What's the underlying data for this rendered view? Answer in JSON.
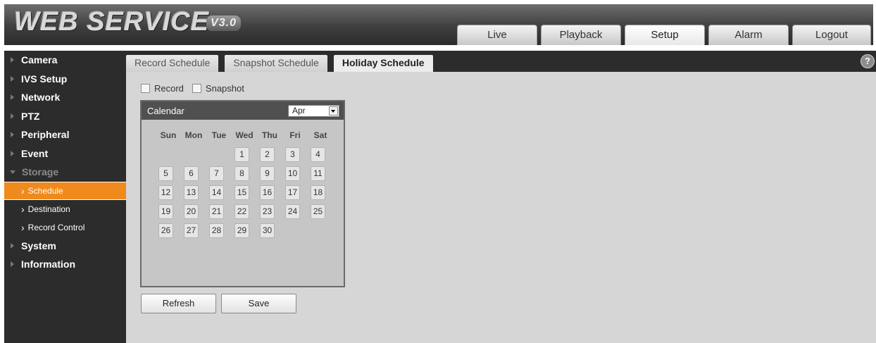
{
  "header": {
    "logo_text": "WEB SERVICE",
    "logo_version": "V3.0",
    "nav": [
      {
        "label": "Live",
        "active": false
      },
      {
        "label": "Playback",
        "active": false
      },
      {
        "label": "Setup",
        "active": true
      },
      {
        "label": "Alarm",
        "active": false
      },
      {
        "label": "Logout",
        "active": false
      }
    ]
  },
  "sidebar": {
    "items": [
      {
        "label": "Camera"
      },
      {
        "label": "IVS Setup"
      },
      {
        "label": "Network"
      },
      {
        "label": "PTZ"
      },
      {
        "label": "Peripheral"
      },
      {
        "label": "Event"
      },
      {
        "label": "Storage",
        "expanded": true
      },
      {
        "label": "System"
      },
      {
        "label": "Information"
      }
    ],
    "storage_children": [
      {
        "label": "Schedule",
        "active": true
      },
      {
        "label": "Destination",
        "active": false
      },
      {
        "label": "Record Control",
        "active": false
      }
    ],
    "accent_color": "#f08a1c"
  },
  "subtabs": [
    {
      "label": "Record Schedule",
      "active": false
    },
    {
      "label": "Snapshot Schedule",
      "active": false
    },
    {
      "label": "Holiday Schedule",
      "active": true
    }
  ],
  "help_icon": "?",
  "options": {
    "record_label": "Record",
    "record_checked": false,
    "snapshot_label": "Snapshot",
    "snapshot_checked": false
  },
  "calendar": {
    "title": "Calendar",
    "month": "Apr",
    "weekdays": [
      "Sun",
      "Mon",
      "Tue",
      "Wed",
      "Thu",
      "Fri",
      "Sat"
    ],
    "first_weekday_index": 3,
    "days": [
      "1",
      "2",
      "3",
      "4",
      "5",
      "6",
      "7",
      "8",
      "9",
      "10",
      "11",
      "12",
      "13",
      "14",
      "15",
      "16",
      "17",
      "18",
      "19",
      "20",
      "21",
      "22",
      "23",
      "24",
      "25",
      "26",
      "27",
      "28",
      "29",
      "30"
    ]
  },
  "buttons": {
    "refresh": "Refresh",
    "save": "Save"
  }
}
